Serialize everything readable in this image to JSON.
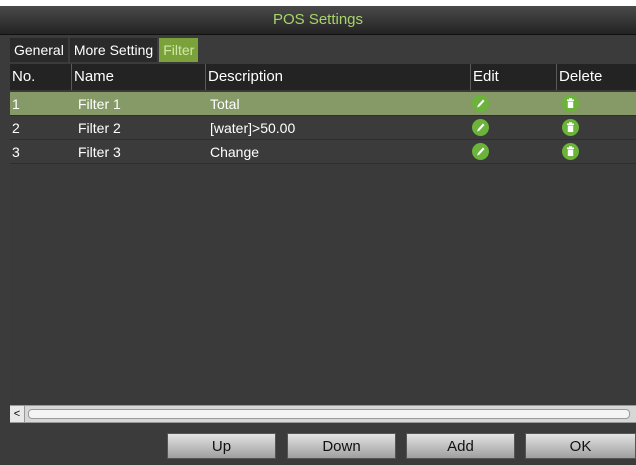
{
  "window": {
    "title": "POS Settings"
  },
  "tabs": [
    {
      "label": "General",
      "active": false
    },
    {
      "label": "More Setting",
      "active": false
    },
    {
      "label": "Filter",
      "active": true
    }
  ],
  "table": {
    "headers": {
      "no": "No.",
      "name": "Name",
      "description": "Description",
      "edit": "Edit",
      "delete": "Delete"
    },
    "rows": [
      {
        "no": "1",
        "name": "Filter 1",
        "description": "Total",
        "selected": true
      },
      {
        "no": "2",
        "name": "Filter 2",
        "description": "[water]>50.00",
        "selected": false
      },
      {
        "no": "3",
        "name": "Filter 3",
        "description": "Change",
        "selected": false
      }
    ],
    "row_actions": {
      "edit_icon": "pencil-icon",
      "delete_icon": "trash-icon"
    }
  },
  "scrollbar": {
    "left_arrow": "<"
  },
  "buttons": {
    "up": "Up",
    "down": "Down",
    "add": "Add",
    "ok": "OK"
  },
  "colors": {
    "accent_green": "#a8d46a",
    "active_tab": "#7ba23a",
    "selected_row": "#859a66",
    "action_icon": "#6bb33a",
    "panel": "#3b3b3b"
  }
}
